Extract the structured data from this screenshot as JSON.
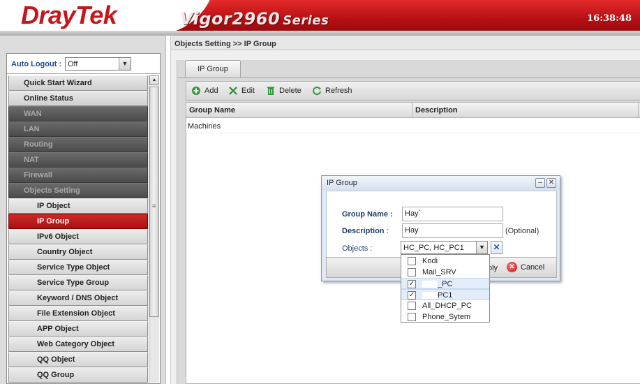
{
  "header": {
    "brand": "DrayTek",
    "model": "Vigor2960",
    "series": "Series",
    "clock": "16:38:48"
  },
  "sidebar": {
    "autologout_label": "Auto Logout :",
    "autologout_value": "Off",
    "items": [
      {
        "label": "Quick Start Wizard",
        "kind": "top"
      },
      {
        "label": "Online Status",
        "kind": "top"
      },
      {
        "label": "WAN",
        "kind": "dis"
      },
      {
        "label": "LAN",
        "kind": "dis"
      },
      {
        "label": "Routing",
        "kind": "dis"
      },
      {
        "label": "NAT",
        "kind": "dis"
      },
      {
        "label": "Firewall",
        "kind": "dis"
      },
      {
        "label": "Objects Setting",
        "kind": "dis"
      },
      {
        "label": "IP Object",
        "kind": "sub"
      },
      {
        "label": "IP Group",
        "kind": "sub active"
      },
      {
        "label": "IPv6 Object",
        "kind": "sub"
      },
      {
        "label": "Country Object",
        "kind": "sub"
      },
      {
        "label": "Service Type Object",
        "kind": "sub"
      },
      {
        "label": "Service Type Group",
        "kind": "sub"
      },
      {
        "label": "Keyword / DNS Object",
        "kind": "sub"
      },
      {
        "label": "File Extension Object",
        "kind": "sub"
      },
      {
        "label": "APP Object",
        "kind": "sub"
      },
      {
        "label": "Web Category Object",
        "kind": "sub"
      },
      {
        "label": "QQ Object",
        "kind": "sub"
      },
      {
        "label": "QQ Group",
        "kind": "sub"
      }
    ]
  },
  "main": {
    "breadcrumb": "Objects Setting >> IP Group",
    "tab": "IP Group",
    "toolbar": {
      "add": "Add",
      "edit": "Edit",
      "delete": "Delete",
      "refresh": "Refresh"
    },
    "columns": [
      "Group Name",
      "Description"
    ],
    "rows": [
      {
        "name": "Machines",
        "description": ""
      }
    ]
  },
  "dialog": {
    "title": "IP Group",
    "group_name_label": "Group Name :",
    "group_name_value": "Hay`",
    "description_label": "Description",
    "description_colon": " :",
    "description_value": "Hay",
    "optional": "(Optional)",
    "objects_label": "Objects :",
    "objects_value": "HC_PC, HC_PC1",
    "apply_fragment": "ply",
    "cancel": "Cancel"
  },
  "objects_dropdown": [
    {
      "label": "Kodi",
      "checked": false,
      "masked": false
    },
    {
      "label": "Mail_SRV",
      "checked": false,
      "masked": false
    },
    {
      "label": "_PC",
      "checked": true,
      "masked": true
    },
    {
      "label": "PC1",
      "checked": true,
      "masked": true
    },
    {
      "label": "All_DHCP_PC",
      "checked": false,
      "masked": false
    },
    {
      "label": "Phone_Sytem",
      "checked": false,
      "masked": false
    }
  ]
}
